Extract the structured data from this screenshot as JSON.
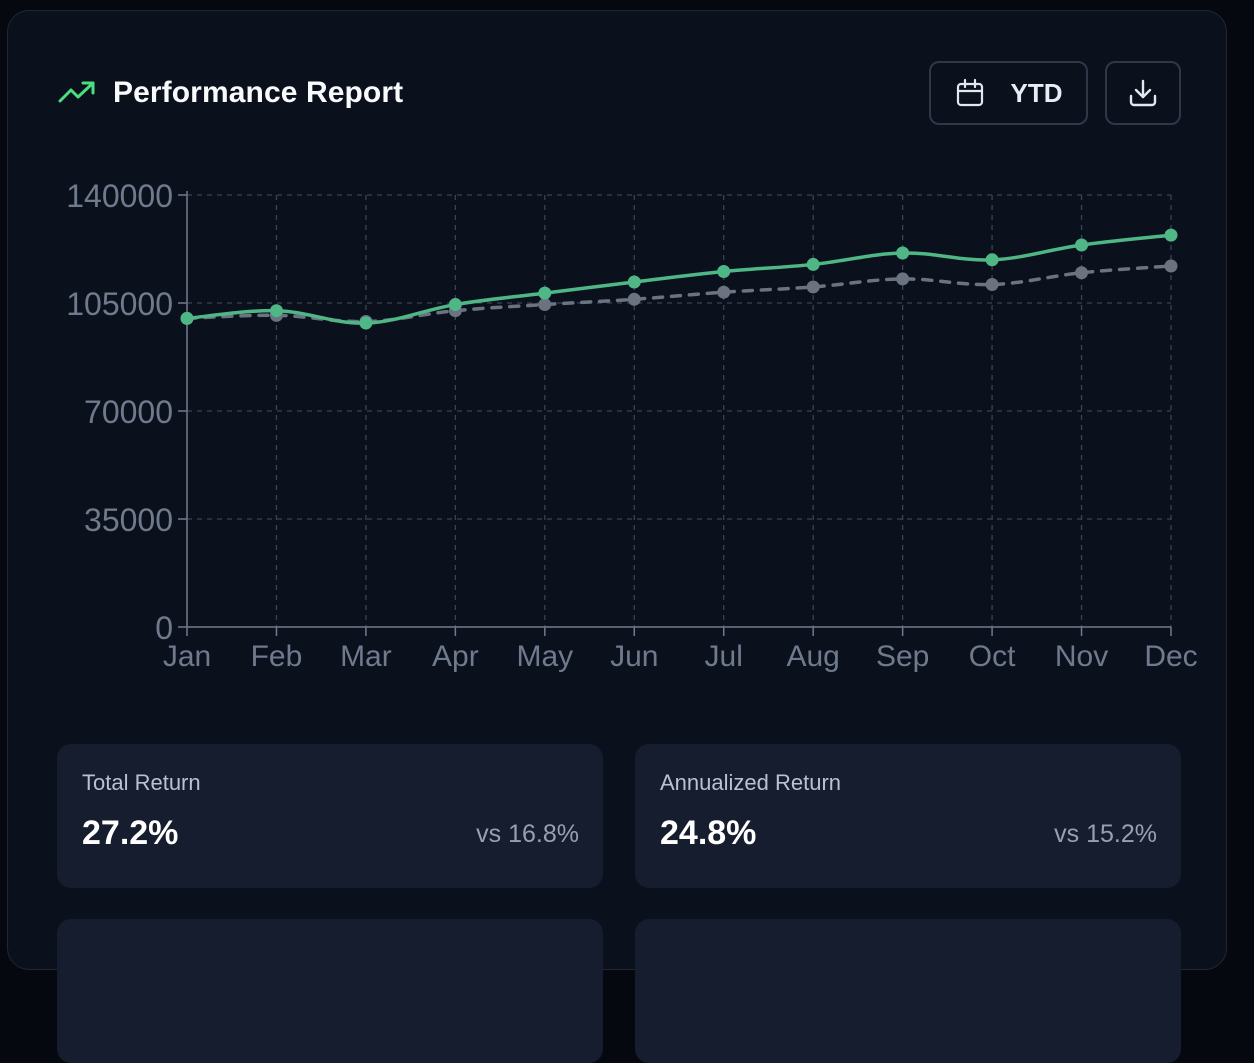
{
  "header": {
    "title": "Performance Report",
    "title_icon": "trending-up-icon",
    "accent_color": "#4ade80"
  },
  "toolbar": {
    "period_label": "YTD",
    "period_icon": "calendar-icon",
    "download_icon": "download-icon"
  },
  "chart_data": {
    "type": "line",
    "categories": [
      "Jan",
      "Feb",
      "Mar",
      "Apr",
      "May",
      "Jun",
      "Jul",
      "Aug",
      "Sep",
      "Oct",
      "Nov",
      "Dec"
    ],
    "series": [
      {
        "values": [
          100000,
          102500,
          98500,
          104500,
          108200,
          111800,
          115200,
          117500,
          121200,
          119000,
          123800,
          127000
        ],
        "color": "#4fb786",
        "style": "solid"
      },
      {
        "values": [
          100000,
          101000,
          99000,
          102500,
          104500,
          106200,
          108500,
          110200,
          112800,
          111000,
          114800,
          117000
        ],
        "color": "#6b7280",
        "style": "dashed"
      }
    ],
    "yticks": [
      0,
      35000,
      70000,
      105000,
      140000
    ],
    "ylim": [
      0,
      140000
    ],
    "grid": true,
    "legend": "none"
  },
  "stats": [
    {
      "label": "Total Return",
      "value": "27.2%",
      "benchmark": "vs 16.8%"
    },
    {
      "label": "Annualized Return",
      "value": "24.8%",
      "benchmark": "vs 15.2%"
    }
  ]
}
